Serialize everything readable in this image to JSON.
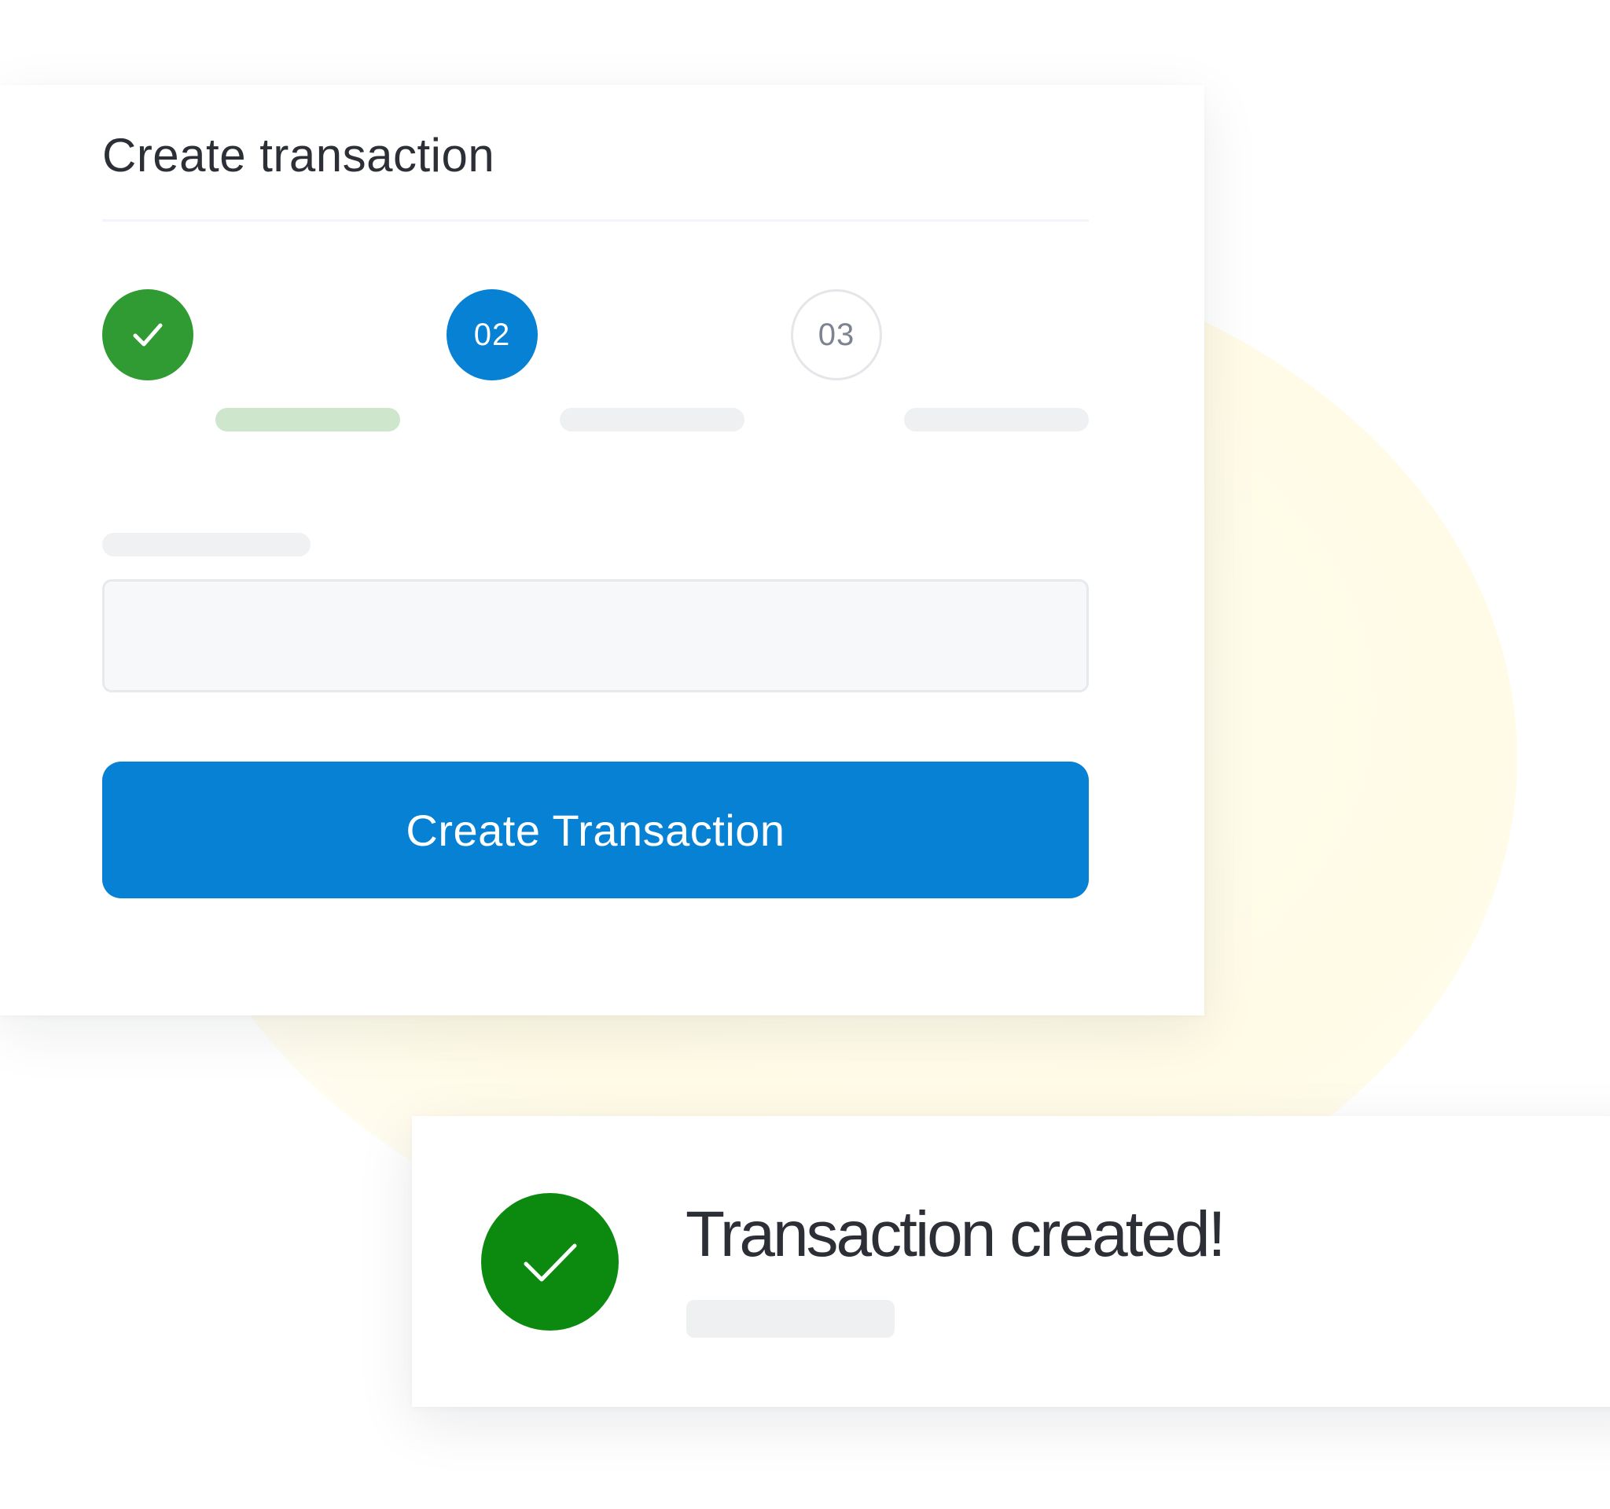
{
  "create_card": {
    "title": "Create transaction",
    "steps": [
      {
        "number": "",
        "state": "completed",
        "icon": "check-icon",
        "progress": 1.0
      },
      {
        "number": "02",
        "state": "active",
        "progress": 0
      },
      {
        "number": "03",
        "state": "pending",
        "progress": 0
      }
    ],
    "field": {
      "label": "",
      "value": "",
      "placeholder": ""
    },
    "submit_label": "Create Transaction"
  },
  "toast": {
    "icon": "check-icon",
    "title": "Transaction created!",
    "subtitle": ""
  },
  "colors": {
    "primary": "#0781d3",
    "success": "#2f9b32",
    "success_dark": "#0c8a10",
    "success_light": "#cde6cc",
    "text": "#2d2f36",
    "muted": "#7d8390",
    "placeholder_bar": "#eff0f2",
    "blob": "#fffbe6"
  }
}
